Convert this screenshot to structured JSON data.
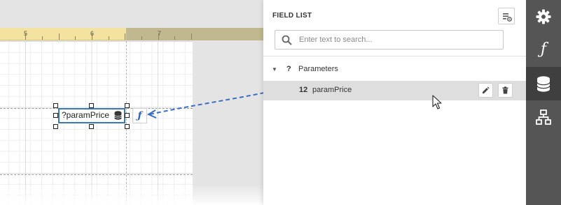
{
  "canvas": {
    "ruler_labels": [
      "5",
      "6",
      "7"
    ],
    "label_control": {
      "text": "?paramPrice",
      "icon": "database-icon"
    },
    "smart_tag": {
      "glyph": "ƒ"
    }
  },
  "field_list": {
    "title": "FIELD LIST",
    "search": {
      "placeholder": "Enter text to search...",
      "value": ""
    },
    "tree": {
      "group": {
        "expander": "▼",
        "type_glyph": "?",
        "label": "Parameters"
      },
      "item": {
        "type_glyph": "12",
        "label": "paramPrice",
        "selected": true
      }
    }
  },
  "tabstrip": {
    "tabs": [
      {
        "name": "properties",
        "icon": "gear-icon"
      },
      {
        "name": "expressions",
        "glyph": "ƒ"
      },
      {
        "name": "field-list",
        "icon": "database-icon",
        "active": true
      },
      {
        "name": "report-explorer",
        "icon": "hierarchy-icon"
      }
    ]
  },
  "colors": {
    "accent": "#3a78b8",
    "ruler": "#f3e2a0",
    "tabstrip": "#555555",
    "tabstrip_active": "#3f3f3f",
    "selected_row": "#dedede"
  }
}
